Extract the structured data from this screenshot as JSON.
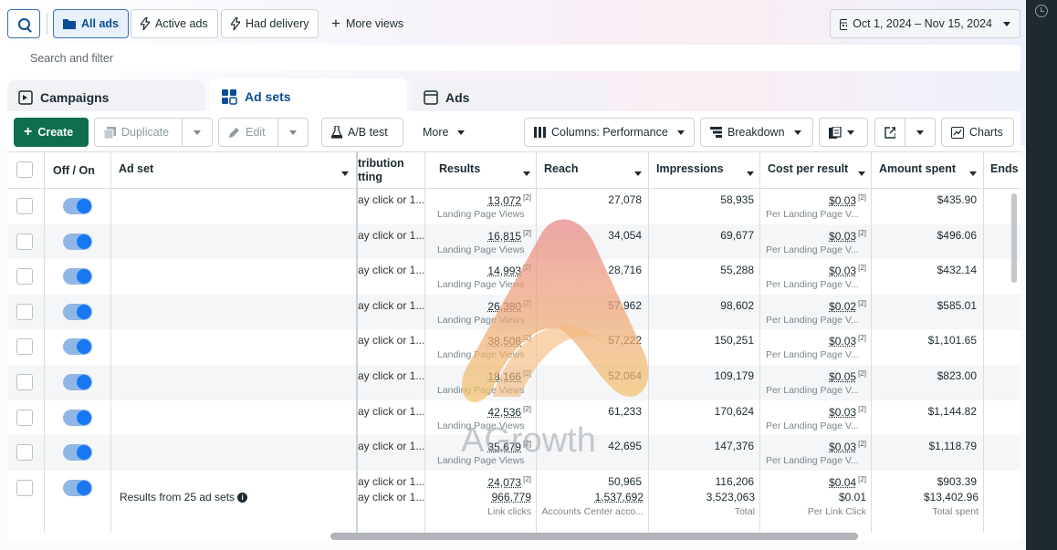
{
  "top": {
    "views": [
      "All ads",
      "Active ads",
      "Had delivery"
    ],
    "more_views": "More views",
    "date_range": "Oct 1, 2024 – Nov 15, 2024"
  },
  "search": {
    "placeholder": "Search and filter"
  },
  "tabs": [
    "Campaigns",
    "Ad sets",
    "Ads"
  ],
  "toolbar": {
    "create": "Create",
    "duplicate": "Duplicate",
    "edit": "Edit",
    "ab_test": "A/B test",
    "more": "More",
    "columns": "Columns: Performance",
    "breakdown": "Breakdown",
    "charts": "Charts"
  },
  "table": {
    "headers": {
      "off_on": "Off / On",
      "ad_set": "Ad set",
      "attribution": "tribution tting",
      "results": "Results",
      "reach": "Reach",
      "impressions": "Impressions",
      "cost_per_result": "Cost per result",
      "amount_spent": "Amount spent",
      "ends": "Ends"
    },
    "rows": [
      {
        "attribution": "ay click or 1...",
        "results": "13,072",
        "results_sub": "Landing Page Views",
        "reach": "27,078",
        "impressions": "58,935",
        "cpr": "$0.03",
        "cpr_sub": "Per Landing Page V...",
        "spent": "$435.90"
      },
      {
        "attribution": "ay click or 1...",
        "results": "16,815",
        "results_sub": "Landing Page Views",
        "reach": "34,054",
        "impressions": "69,677",
        "cpr": "$0.03",
        "cpr_sub": "Per Landing Page V...",
        "spent": "$496.06"
      },
      {
        "attribution": "ay click or 1...",
        "results": "14,993",
        "results_sub": "Landing Page Views",
        "reach": "28,716",
        "impressions": "55,288",
        "cpr": "$0.03",
        "cpr_sub": "Per Landing Page V...",
        "spent": "$432.14"
      },
      {
        "attribution": "ay click or 1...",
        "results": "26,380",
        "results_sub": "Landing Page Views",
        "reach": "57,962",
        "impressions": "98,602",
        "cpr": "$0.02",
        "cpr_sub": "Per Landing Page V...",
        "spent": "$585.01"
      },
      {
        "attribution": "ay click or 1...",
        "results": "38,508",
        "results_sub": "Landing Page Views",
        "reach": "57,222",
        "impressions": "150,251",
        "cpr": "$0.03",
        "cpr_sub": "Per Landing Page V...",
        "spent": "$1,101.65"
      },
      {
        "attribution": "ay click or 1...",
        "results": "18,166",
        "results_sub": "Landing Page Views",
        "reach": "52,064",
        "impressions": "109,179",
        "cpr": "$0.05",
        "cpr_sub": "Per Landing Page V...",
        "spent": "$823.00"
      },
      {
        "attribution": "ay click or 1...",
        "results": "42,536",
        "results_sub": "Landing Page Views",
        "reach": "61,233",
        "impressions": "170,624",
        "cpr": "$0.03",
        "cpr_sub": "Per Landing Page V...",
        "spent": "$1,144.82"
      },
      {
        "attribution": "ay click or 1...",
        "results": "35,679",
        "results_sub": "Landing Page Views",
        "reach": "42,695",
        "impressions": "147,376",
        "cpr": "$0.03",
        "cpr_sub": "Per Landing Page V...",
        "spent": "$1,118.79"
      },
      {
        "attribution": "ay click or 1...",
        "results": "24,073",
        "results_sub": "",
        "reach": "50,965",
        "impressions": "116,206",
        "cpr": "$0.04",
        "cpr_sub": "",
        "spent": "$903.39"
      }
    ],
    "sup_mark": "[2]",
    "totals": {
      "label": "Results from 25 ad sets",
      "attribution": "ay click or 1...",
      "results": "966,779",
      "results_sub": "Link clicks",
      "reach": "1,537,692",
      "reach_sub": "Accounts Center acco...",
      "impressions": "3,523,063",
      "impressions_sub": "Total",
      "cpr": "$0.01",
      "cpr_sub": "Per Link Click",
      "spent": "$13,402.96",
      "spent_sub": "Total spent"
    }
  },
  "watermark": {
    "text": "AGrowth"
  },
  "colors": {
    "accent": "#0a4d94",
    "create_green": "#0f6e4f",
    "toggle_on": "#1877f2"
  }
}
